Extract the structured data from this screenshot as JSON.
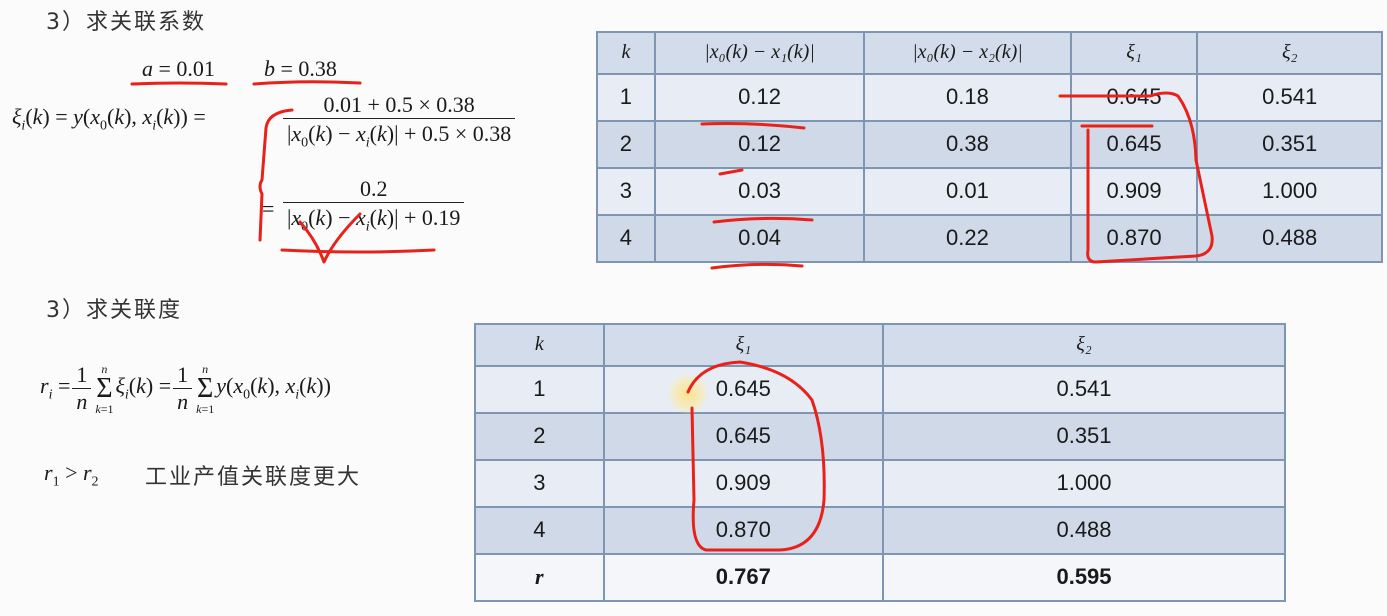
{
  "section1": {
    "heading": "3）求关联系数",
    "a_label": "a = 0.01",
    "b_label": "b = 0.38",
    "lhs": "ξi(k) = y(x0(k), xi(k))",
    "eq": "=",
    "frac1_num": "0.01 + 0.5 × 0.38",
    "frac1_den": "|x0(k) − xi(k)| + 0.5 × 0.38",
    "frac2_num": "0.2",
    "frac2_den": "|x0(k) − xi(k)| + 0.19"
  },
  "table1": {
    "headers": [
      "k",
      "|x₀(k) − x₁(k)|",
      "|x₀(k) − x₂(k)|",
      "ξ₁",
      "ξ₂"
    ],
    "rows": [
      [
        "1",
        "0.12",
        "0.18",
        "0.645",
        "0.541"
      ],
      [
        "2",
        "0.12",
        "0.38",
        "0.645",
        "0.351"
      ],
      [
        "3",
        "0.03",
        "0.01",
        "0.909",
        "1.000"
      ],
      [
        "4",
        "0.04",
        "0.22",
        "0.870",
        "0.488"
      ]
    ]
  },
  "section2": {
    "heading": "3）求关联度",
    "formula": "ri = (1/n) Σ ξi(k) = (1/n) Σ y(x0(k), xi(k))",
    "conclusion_math": "r1 > r2",
    "conclusion_text": "工业产值关联度更大"
  },
  "table2": {
    "headers": [
      "k",
      "ξ₁",
      "ξ₂"
    ],
    "rows": [
      [
        "1",
        "0.645",
        "0.541"
      ],
      [
        "2",
        "0.645",
        "0.351"
      ],
      [
        "3",
        "0.909",
        "1.000"
      ],
      [
        "4",
        "0.870",
        "0.488"
      ]
    ],
    "total": [
      "r",
      "0.767",
      "0.595"
    ]
  },
  "annotation_color": "#e8211b"
}
